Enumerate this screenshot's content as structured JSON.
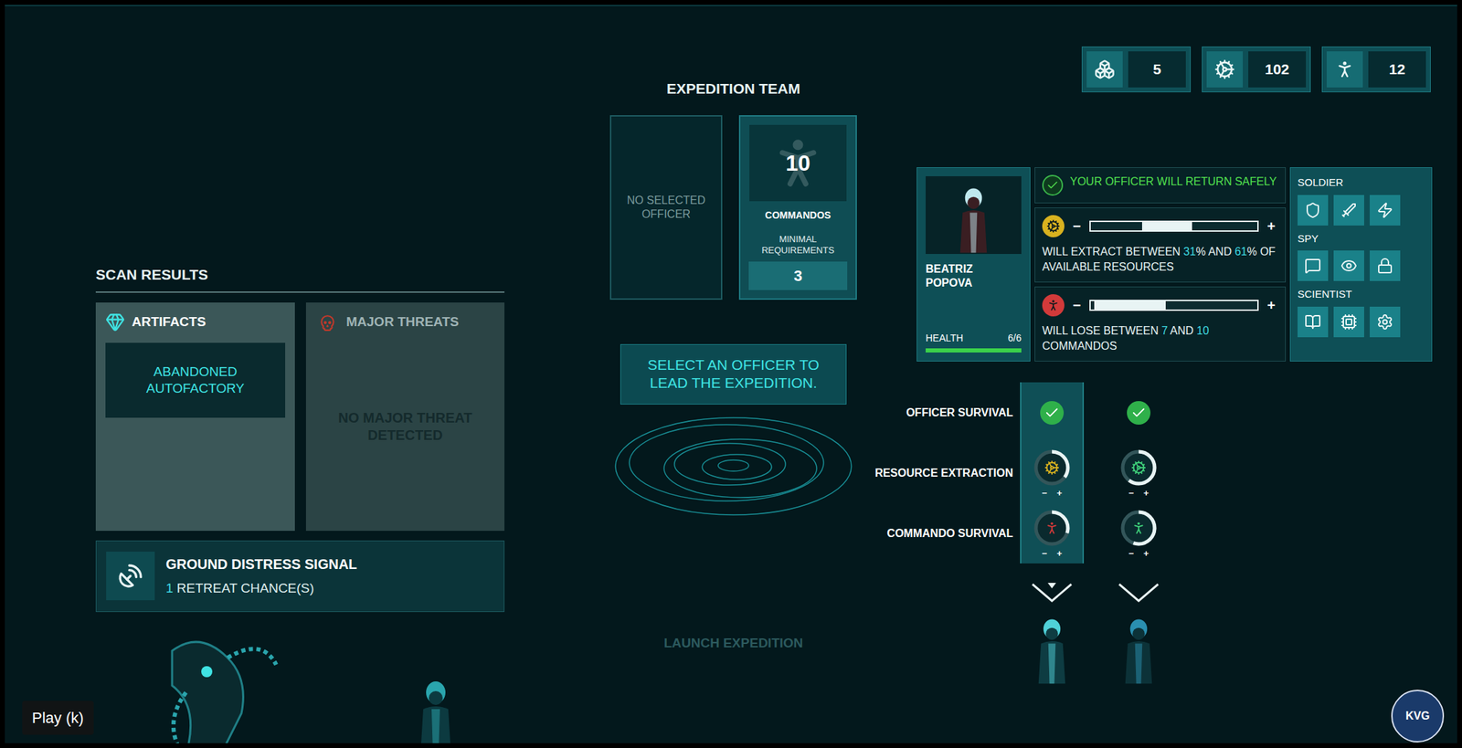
{
  "resources": [
    {
      "value": "5"
    },
    {
      "value": "102"
    },
    {
      "value": "12"
    }
  ],
  "expedition_team": {
    "title": "EXPEDITION TEAM",
    "officer_slot": {
      "text": "NO SELECTED OFFICER",
      "filled": false
    },
    "commandos": {
      "count": "10",
      "label": "COMMANDOS",
      "requirement_label": "MINIMAL REQUIREMENTS",
      "requirement": "3"
    },
    "prompt": "SELECT AN OFFICER TO LEAD THE EXPEDITION.",
    "launch_button": {
      "label": "LAUNCH EXPEDITION",
      "disabled": true
    }
  },
  "scan_results": {
    "title": "SCAN RESULTS",
    "artifacts": {
      "title": "ARTIFACTS",
      "items": [
        "ABANDONED AUTOFACTORY"
      ],
      "active": true
    },
    "major_threats": {
      "title": "MAJOR THREATS",
      "empty_text": "NO MAJOR THREAT DETECTED",
      "active": false
    }
  },
  "distress_signal": {
    "title": "GROUND DISTRESS SIGNAL",
    "count": "1",
    "label": "RETREAT CHANCE(S)"
  },
  "officer": {
    "name": "BEATRIZ POPOVA",
    "health_label": "HEALTH",
    "health": "6/6",
    "health_level": 1,
    "survival": {
      "safe": true,
      "text": "YOUR OFFICER WILL RETURN SAFELY"
    },
    "extraction": {
      "minus": "−",
      "plus": "+",
      "range_low": 0.31,
      "range_high": 0.61,
      "parts": [
        {
          "text": "WILL EXTRACT BETWEEN ",
          "highlight": false
        },
        {
          "text": "31",
          "highlight": true
        },
        {
          "text": "% AND ",
          "highlight": false
        },
        {
          "text": "61",
          "highlight": true
        },
        {
          "text": "% OF AVAILABLE RESOURCES",
          "highlight": false
        }
      ]
    },
    "commando_loss": {
      "minus": "−",
      "plus": "+",
      "range_low": 0.02,
      "range_high": 0.45,
      "parts": [
        {
          "text": "WILL LOSE BETWEEN ",
          "highlight": false
        },
        {
          "text": "7",
          "highlight": true
        },
        {
          "text": " AND ",
          "highlight": false
        },
        {
          "text": "10",
          "highlight": true
        },
        {
          "text": " COMMANDOS",
          "highlight": false
        }
      ]
    }
  },
  "skills": [
    {
      "label": "SOLDIER"
    },
    {
      "label": "SPY"
    },
    {
      "label": "SCIENTIST"
    }
  ],
  "comparison": {
    "rows": [
      "OFFICER SURVIVAL",
      "RESOURCE EXTRACTION",
      "COMMANDO SURVIVAL"
    ],
    "controls": {
      "minus": "−",
      "plus": "+"
    },
    "officers": [
      {
        "selected": true,
        "survives": true,
        "extraction": {
          "level": 0.35,
          "color": "#d9b21f"
        },
        "commando": {
          "level": 0.3,
          "color": "#d23a3a"
        }
      },
      {
        "selected": false,
        "survives": true,
        "extraction": {
          "level": 0.6,
          "color": "#3fd07a"
        },
        "commando": {
          "level": 0.55,
          "color": "#3fd07a"
        }
      }
    ]
  },
  "video_overlay": {
    "label": "Play (k)"
  },
  "watermark": {
    "text": "KVG"
  }
}
